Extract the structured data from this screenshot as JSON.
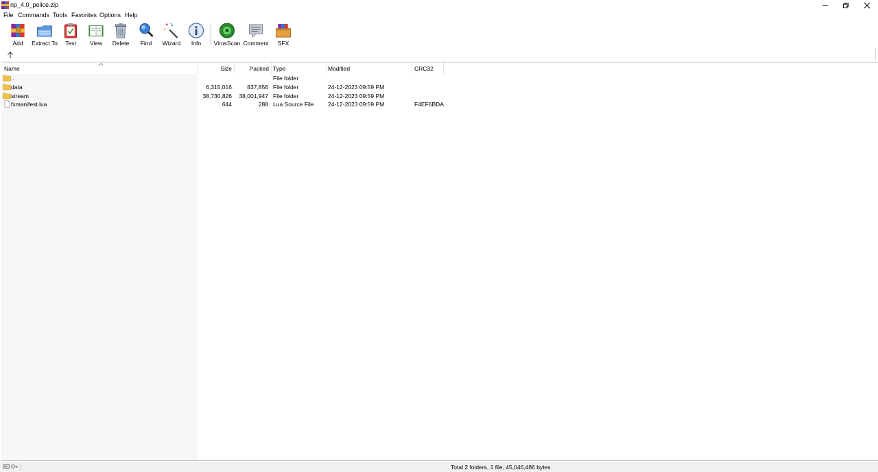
{
  "window": {
    "title": "np_4.0_police.zip",
    "buttons": [
      "minimize",
      "restore",
      "close"
    ]
  },
  "menu": [
    "File",
    "Commands",
    "Tools",
    "Favorites",
    "Options",
    "Help"
  ],
  "toolbar": [
    {
      "label": "Add",
      "icon": "add-archive-icon"
    },
    {
      "label": "Extract To",
      "icon": "extract-folder-icon"
    },
    {
      "label": "Test",
      "icon": "test-clipboard-icon"
    },
    {
      "label": "View",
      "icon": "view-book-icon"
    },
    {
      "label": "Delete",
      "icon": "trash-icon"
    },
    {
      "label": "Find",
      "icon": "magnifier-icon"
    },
    {
      "label": "Wizard",
      "icon": "magic-wand-icon"
    },
    {
      "label": "Info",
      "icon": "info-icon"
    },
    {
      "label": "VirusScan",
      "icon": "virus-scan-icon"
    },
    {
      "label": "Comment",
      "icon": "comment-icon"
    },
    {
      "label": "SFX",
      "icon": "sfx-archive-icon"
    }
  ],
  "columns": [
    "Name",
    "Size",
    "Packed",
    "Type",
    "Modified",
    "CRC32"
  ],
  "rows": [
    {
      "name": "..",
      "size": "",
      "packed": "",
      "type": "File folder",
      "modified": "",
      "crc": "",
      "icon": "folder-icon"
    },
    {
      "name": "data",
      "size": "6,315,016",
      "packed": "837,856",
      "type": "File folder",
      "modified": "24-12-2023 09:59 PM",
      "crc": "",
      "icon": "folder-icon"
    },
    {
      "name": "stream",
      "size": "38,730,826",
      "packed": "38,001,947",
      "type": "File folder",
      "modified": "24-12-2023 09:59 PM",
      "crc": "",
      "icon": "folder-icon"
    },
    {
      "name": "fxmanifest.lua",
      "size": "644",
      "packed": "288",
      "type": "Lua Source File",
      "modified": "24-12-2023 09:59 PM",
      "crc": "F4EF6BDA",
      "icon": "file-icon"
    }
  ],
  "status": {
    "text": "Total 2 folders, 1 file, 45,046,486 bytes"
  }
}
